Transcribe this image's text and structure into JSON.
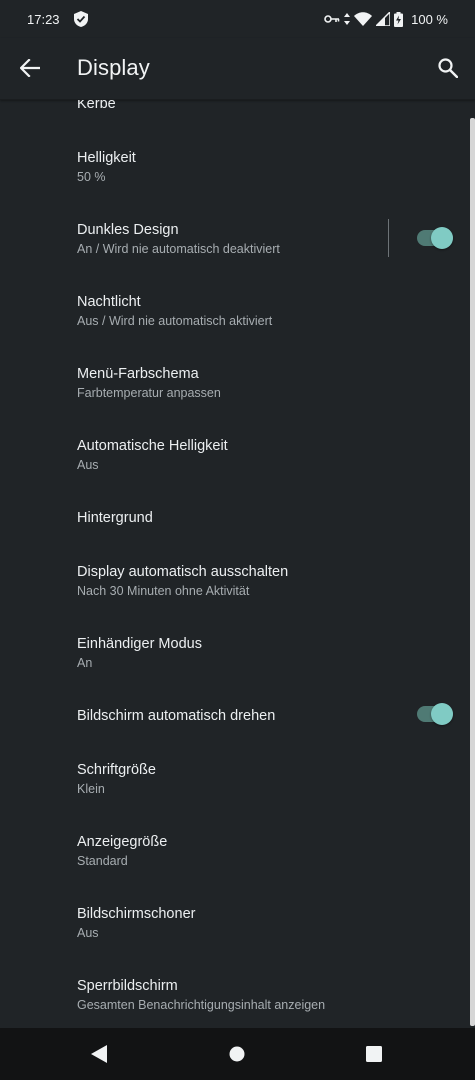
{
  "status_bar": {
    "time": "17:23",
    "battery": "100 %",
    "icons": [
      "shield-check-icon",
      "vpn-key-icon",
      "data-arrows-icon",
      "wifi-icon",
      "signal-icon",
      "battery-charging-icon"
    ]
  },
  "app_bar": {
    "title": "Display",
    "back_icon": "arrow-back-icon",
    "search_icon": "search-icon"
  },
  "items": [
    {
      "title": "Kerbe",
      "subtitle": ""
    },
    {
      "title": "Helligkeit",
      "subtitle": "50 %"
    },
    {
      "title": "Dunkles Design",
      "subtitle": "An / Wird nie automatisch deaktiviert",
      "toggle": true
    },
    {
      "title": "Nachtlicht",
      "subtitle": "Aus / Wird nie automatisch aktiviert"
    },
    {
      "title": "Menü-Farbschema",
      "subtitle": "Farbtemperatur anpassen"
    },
    {
      "title": "Automatische Helligkeit",
      "subtitle": "Aus"
    },
    {
      "title": "Hintergrund",
      "subtitle": ""
    },
    {
      "title": "Display automatisch ausschalten",
      "subtitle": "Nach 30 Minuten ohne Aktivität"
    },
    {
      "title": "Einhändiger Modus",
      "subtitle": "An"
    },
    {
      "title": "Bildschirm automatisch drehen",
      "subtitle": "",
      "toggle": true
    },
    {
      "title": "Schriftgröße",
      "subtitle": "Klein"
    },
    {
      "title": "Anzeigegröße",
      "subtitle": "Standard"
    },
    {
      "title": "Bildschirmschoner",
      "subtitle": "Aus"
    },
    {
      "title": "Sperrbildschirm",
      "subtitle": "Gesamten Benachrichtigungsinhalt anzeigen"
    }
  ],
  "nav_bar": {
    "icons": [
      "back-triangle-icon",
      "home-circle-icon",
      "recents-square-icon"
    ]
  },
  "colors": {
    "background": "#202427",
    "toggle_thumb": "#80cbc4",
    "toggle_track": "#4f7a74"
  }
}
